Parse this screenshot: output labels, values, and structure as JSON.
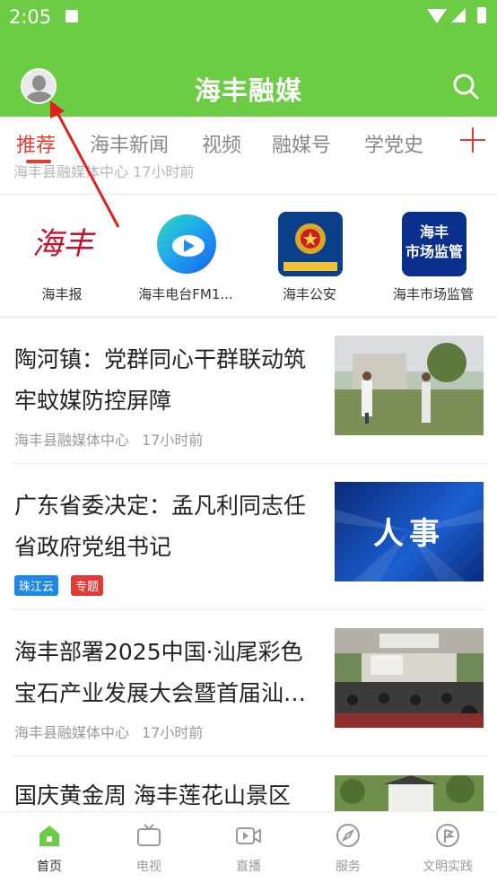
{
  "status_bar": {
    "time": "2:05"
  },
  "header": {
    "title": "海丰融媒"
  },
  "tabs": [
    {
      "label": "推荐"
    },
    {
      "label": "海丰新闻"
    },
    {
      "label": "视频"
    },
    {
      "label": "融媒号"
    },
    {
      "label": "学党史"
    }
  ],
  "cutoff_item": {
    "meta": "海丰县融媒体中心   17小时前"
  },
  "shortcuts": [
    {
      "label": "海丰报",
      "icon": "haifeng-newspaper-logo"
    },
    {
      "label": "海丰电台FM1...",
      "icon": "radio-logo"
    },
    {
      "label": "海丰公安",
      "icon": "police-logo"
    },
    {
      "label": "海丰市场监管",
      "icon": "market-logo",
      "icon_text": [
        "海丰",
        "市场监管"
      ]
    }
  ],
  "news": [
    {
      "title": "陶河镇：党群同心干群联动筑牢蚊媒防控屏障",
      "source": "海丰县融媒体中心",
      "time": "17小时前"
    },
    {
      "title": "广东省委决定：孟凡利同志任省政府党组书记",
      "tags": [
        {
          "label": "珠江云",
          "color": "#1e88e5"
        },
        {
          "label": "专题",
          "color": "#e53935"
        }
      ],
      "thumb_text": "人事"
    },
    {
      "title": "海丰部署2025中国·汕尾彩色宝石产业发展大会暨首届汕…",
      "source": "海丰县融媒体中心",
      "time": "17小时前"
    },
    {
      "title": "国庆黄金周 海丰莲花山景区"
    }
  ],
  "bottom_nav": [
    {
      "label": "首页",
      "icon": "home-icon",
      "active": true
    },
    {
      "label": "电视",
      "icon": "tv-icon"
    },
    {
      "label": "直播",
      "icon": "live-video-icon"
    },
    {
      "label": "服务",
      "icon": "compass-icon"
    },
    {
      "label": "文明实践",
      "icon": "flag-circle-icon"
    }
  ],
  "colors": {
    "brand_green": "#6ccd45",
    "accent_red": "#e23b2f"
  }
}
